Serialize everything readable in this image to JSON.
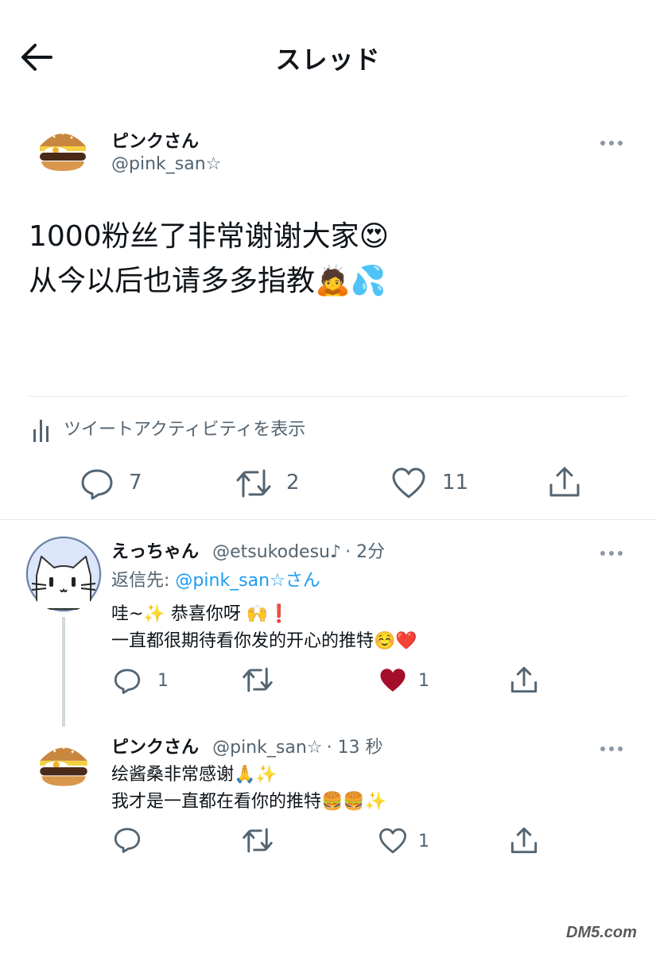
{
  "header": {
    "title": "スレッド"
  },
  "main_tweet": {
    "user_name": "ピンクさん",
    "handle": "@pink_san☆",
    "text_line1": "1000粉丝了非常谢谢大家😍",
    "text_line2": "从今以后也请多多指教🙇💦",
    "activity_label": "ツイートアクティビティを表示",
    "reply_count": "7",
    "retweet_count": "2",
    "like_count": "11"
  },
  "replies": [
    {
      "user_name": "えっちゃん",
      "handle": "@etsukodesu♪",
      "time": "· 2分",
      "reply_to_prefix": "返信先:",
      "reply_to_mention": "@pink_san☆さん",
      "text_line1": "哇~✨ 恭喜你呀 🙌❗",
      "text_line2": "一直都很期待看你发的开心的推特☺️❤️",
      "reply_count": "1",
      "like_count": "1",
      "liked": true
    },
    {
      "user_name": "ピンクさん",
      "handle": "@pink_san☆",
      "time": "· 13 秒",
      "text_line1": "绘酱桑非常感谢🙏✨",
      "text_line2": "我才是一直都在看你的推特🍔🍔✨",
      "like_count": "1",
      "liked": false
    }
  ],
  "watermark": "DM5.com",
  "colors": {
    "like_red": "#a50d2a",
    "mention_blue": "#1d9bf0",
    "icon_gray": "#536471"
  },
  "icons": [
    "back-arrow-icon",
    "more-dots-icon",
    "activity-bars-icon",
    "reply-icon",
    "retweet-icon",
    "heart-icon",
    "share-icon"
  ]
}
